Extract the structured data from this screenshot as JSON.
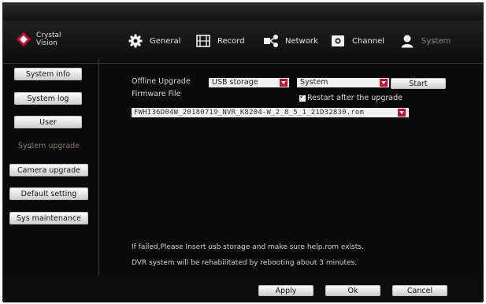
{
  "brand": {
    "line1": "Crystal",
    "line2": "Vision"
  },
  "nav": [
    {
      "label": "General",
      "icon": "gear-icon"
    },
    {
      "label": "Record",
      "icon": "film-icon"
    },
    {
      "label": "Network",
      "icon": "share-icon"
    },
    {
      "label": "Channel",
      "icon": "camera-icon"
    },
    {
      "label": "System",
      "icon": "user-icon"
    }
  ],
  "sidebar": {
    "items": [
      {
        "label": "System info"
      },
      {
        "label": "System log"
      },
      {
        "label": "User"
      },
      {
        "label": "System upgrade"
      },
      {
        "label": "Camera upgrade"
      },
      {
        "label": "Default setting"
      },
      {
        "label": "Sys maintenance"
      }
    ]
  },
  "upgrade": {
    "offline_label": "Offline Upgrade",
    "source_value": "USB storage",
    "target_value": "System",
    "start_label": "Start",
    "firmware_label": "Firmware File",
    "restart_label": "Restart after the upgrade",
    "restart_checked": true,
    "file_value": "FWHI36D04W_20180719_NVR_K8204-W_2_8_5_1_21D32830.rom"
  },
  "notes": {
    "line1": "If failed,Please Insert usb storage and make sure help.rom exists.",
    "line2": "DVR system will be rehabilitated by rebooting about 3 minutes."
  },
  "footer": {
    "apply": "Apply",
    "ok": "Ok",
    "cancel": "Cancel"
  },
  "colors": {
    "accent": "#c8102e",
    "active_item": "#8a7b62",
    "background": "#0a0a0a"
  }
}
